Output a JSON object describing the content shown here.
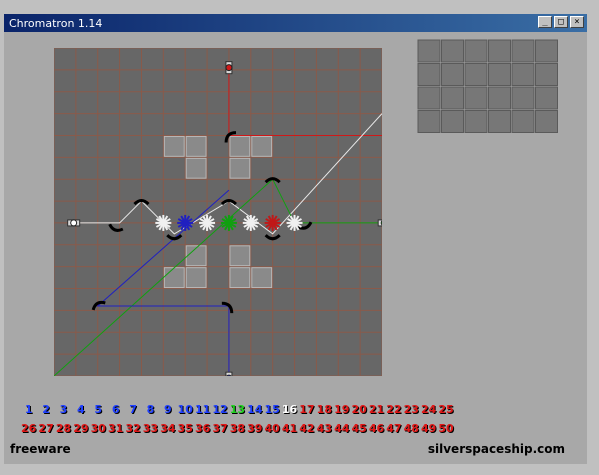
{
  "window": {
    "title": "Chromatron 1.14",
    "minimize": "_",
    "maximize": "□",
    "close": "×"
  },
  "colors": {
    "board_bg": "#676767",
    "grid_line": "#8a5a4a",
    "red_beam": "#d01818",
    "blue_beam": "#2020c0",
    "green_beam": "#10a010",
    "white_beam": "#e8e8e8"
  },
  "board": {
    "cols": 15,
    "rows": 15,
    "icons": [
      "emitter-red-icon",
      "emitter-white-left-icon",
      "emitter-green-right-icon",
      "emitter-blue-icon",
      "mirror-icon",
      "target-icon",
      "target-blue-icon",
      "target-green-icon",
      "target-red-icon"
    ]
  },
  "levels": {
    "row1": [
      {
        "label": "1",
        "status": "blue"
      },
      {
        "label": "2",
        "status": "blue"
      },
      {
        "label": "3",
        "status": "blue"
      },
      {
        "label": "4",
        "status": "blue"
      },
      {
        "label": "5",
        "status": "blue"
      },
      {
        "label": "6",
        "status": "blue"
      },
      {
        "label": "7",
        "status": "blue"
      },
      {
        "label": "8",
        "status": "blue"
      },
      {
        "label": "9",
        "status": "blue"
      },
      {
        "label": "10",
        "status": "blue"
      },
      {
        "label": "11",
        "status": "blue"
      },
      {
        "label": "12",
        "status": "blue"
      },
      {
        "label": "13",
        "status": "green"
      },
      {
        "label": "14",
        "status": "blue"
      },
      {
        "label": "15",
        "status": "blue"
      },
      {
        "label": "16",
        "status": "white"
      },
      {
        "label": "17",
        "status": "red"
      },
      {
        "label": "18",
        "status": "red"
      },
      {
        "label": "19",
        "status": "red"
      },
      {
        "label": "20",
        "status": "red"
      },
      {
        "label": "21",
        "status": "red"
      },
      {
        "label": "22",
        "status": "red"
      },
      {
        "label": "23",
        "status": "red"
      },
      {
        "label": "24",
        "status": "red"
      },
      {
        "label": "25",
        "status": "red"
      }
    ],
    "row2": [
      {
        "label": "26",
        "status": "red"
      },
      {
        "label": "27",
        "status": "red"
      },
      {
        "label": "28",
        "status": "red"
      },
      {
        "label": "29",
        "status": "red"
      },
      {
        "label": "30",
        "status": "red"
      },
      {
        "label": "31",
        "status": "red"
      },
      {
        "label": "32",
        "status": "red"
      },
      {
        "label": "33",
        "status": "red"
      },
      {
        "label": "34",
        "status": "red"
      },
      {
        "label": "35",
        "status": "red"
      },
      {
        "label": "36",
        "status": "red"
      },
      {
        "label": "37",
        "status": "red"
      },
      {
        "label": "38",
        "status": "red"
      },
      {
        "label": "39",
        "status": "red"
      },
      {
        "label": "40",
        "status": "red"
      },
      {
        "label": "41",
        "status": "red"
      },
      {
        "label": "42",
        "status": "red"
      },
      {
        "label": "43",
        "status": "red"
      },
      {
        "label": "44",
        "status": "red"
      },
      {
        "label": "45",
        "status": "red"
      },
      {
        "label": "46",
        "status": "red"
      },
      {
        "label": "47",
        "status": "red"
      },
      {
        "label": "48",
        "status": "red"
      },
      {
        "label": "49",
        "status": "red"
      },
      {
        "label": "50",
        "status": "red"
      }
    ]
  },
  "footer": {
    "left": "freeware",
    "right": "silverspaceship.com"
  }
}
